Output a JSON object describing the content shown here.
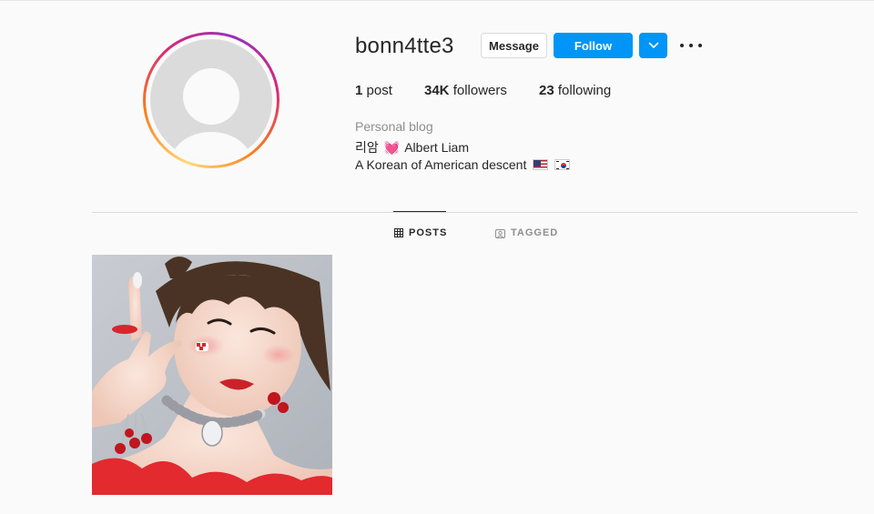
{
  "profile": {
    "username": "bonn4tte3",
    "buttons": {
      "message": "Message",
      "follow": "Follow"
    },
    "stats": {
      "posts_count": "1",
      "posts_label": "post",
      "followers_count": "34K",
      "followers_label": "followers",
      "following_count": "23",
      "following_label": "following"
    },
    "bio": {
      "category": "Personal blog",
      "name_part1": "리암",
      "heart_emoji": "💓",
      "name_part2": "Albert Liam",
      "line2": "A Korean of American descent"
    }
  },
  "tabs": [
    {
      "label": "POSTS",
      "icon": "grid-icon",
      "active": true
    },
    {
      "label": "TAGGED",
      "icon": "tag-user-icon",
      "active": false
    }
  ],
  "posts": [
    {
      "type": "photo"
    }
  ],
  "colors": {
    "accent": "#0095f6",
    "text": "#262626",
    "muted": "#8e8e8e",
    "border": "#dbdbdb",
    "background": "#fafafa"
  }
}
